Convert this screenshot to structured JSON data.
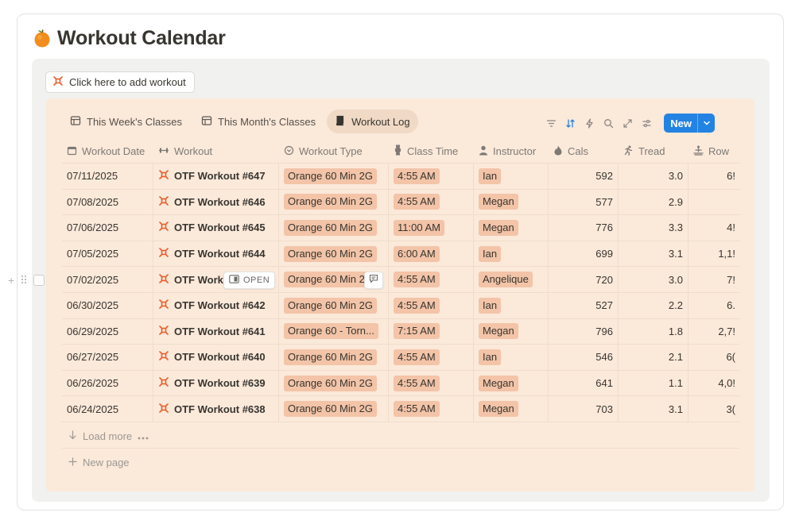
{
  "page": {
    "title": "Workout Calendar",
    "emoji_icon": "orange-fruit-icon",
    "add_button": "Click here to add workout"
  },
  "views": [
    {
      "label": "This Week's Classes",
      "icon": "table-icon",
      "active": false
    },
    {
      "label": "This Month's Classes",
      "icon": "table-icon",
      "active": false
    },
    {
      "label": "Workout Log",
      "icon": "book-icon",
      "active": true
    }
  ],
  "toolbar": {
    "icons": [
      "filter-icon",
      "sort-icon",
      "automation-icon",
      "search-icon",
      "expand-icon",
      "settings-icon"
    ],
    "new_label": "New"
  },
  "columns": [
    {
      "label": "Workout Date",
      "icon": "calendar-icon"
    },
    {
      "label": "Workout",
      "icon": "dumbbell-icon"
    },
    {
      "label": "Workout Type",
      "icon": "select-icon"
    },
    {
      "label": "Class Time",
      "icon": "watch-icon"
    },
    {
      "label": "Instructor",
      "icon": "person-icon"
    },
    {
      "label": "Cals",
      "icon": "flame-icon"
    },
    {
      "label": "Tread",
      "icon": "runner-icon"
    },
    {
      "label": "Row",
      "icon": "rowing-icon"
    }
  ],
  "rows": [
    {
      "date": "07/11/2025",
      "workout": "OTF Workout #647",
      "type": "Orange 60 Min 2G",
      "time": "4:55 AM",
      "instructor": "Ian",
      "cals": "592",
      "tread": "3.0",
      "row": "6!"
    },
    {
      "date": "07/08/2025",
      "workout": "OTF Workout #646",
      "type": "Orange 60 Min 2G",
      "time": "4:55 AM",
      "instructor": "Megan",
      "cals": "577",
      "tread": "2.9",
      "row": ""
    },
    {
      "date": "07/06/2025",
      "workout": "OTF Workout #645",
      "type": "Orange 60 Min 2G",
      "time": "11:00 AM",
      "instructor": "Megan",
      "cals": "776",
      "tread": "3.3",
      "row": "4!"
    },
    {
      "date": "07/05/2025",
      "workout": "OTF Workout #644",
      "type": "Orange 60 Min 2G",
      "time": "6:00 AM",
      "instructor": "Ian",
      "cals": "699",
      "tread": "3.1",
      "row": "1,1!"
    },
    {
      "date": "07/02/2025",
      "workout": "OTF Workout #643",
      "type": "Orange 60 Min 2G",
      "time": "4:55 AM",
      "instructor": "Angelique",
      "cals": "720",
      "tread": "3.0",
      "row": "7!"
    },
    {
      "date": "06/30/2025",
      "workout": "OTF Workout #642",
      "type": "Orange 60 Min 2G",
      "time": "4:55 AM",
      "instructor": "Ian",
      "cals": "527",
      "tread": "2.2",
      "row": "6."
    },
    {
      "date": "06/29/2025",
      "workout": "OTF Workout #641",
      "type": "Orange 60 - Torn...",
      "time": "7:15 AM",
      "instructor": "Megan",
      "cals": "796",
      "tread": "1.8",
      "row": "2,7!"
    },
    {
      "date": "06/27/2025",
      "workout": "OTF Workout #640",
      "type": "Orange 60 Min 2G",
      "time": "4:55 AM",
      "instructor": "Ian",
      "cals": "546",
      "tread": "2.1",
      "row": "6("
    },
    {
      "date": "06/26/2025",
      "workout": "OTF Workout #639",
      "type": "Orange 60 Min 2G",
      "time": "4:55 AM",
      "instructor": "Megan",
      "cals": "641",
      "tread": "1.1",
      "row": "4,0!"
    },
    {
      "date": "06/24/2025",
      "workout": "OTF Workout #638",
      "type": "Orange 60 Min 2G",
      "time": "4:55 AM",
      "instructor": "Megan",
      "cals": "703",
      "tread": "3.1",
      "row": "3("
    }
  ],
  "hover": {
    "open_label": "OPEN"
  },
  "footer": {
    "load_more": "Load more",
    "new_page": "New page"
  },
  "colors": {
    "panel_bg": "#fbe9da",
    "tag_bg": "#f3c4a8",
    "accent": "#2383e2",
    "workout_icon": "#eb5b28"
  }
}
